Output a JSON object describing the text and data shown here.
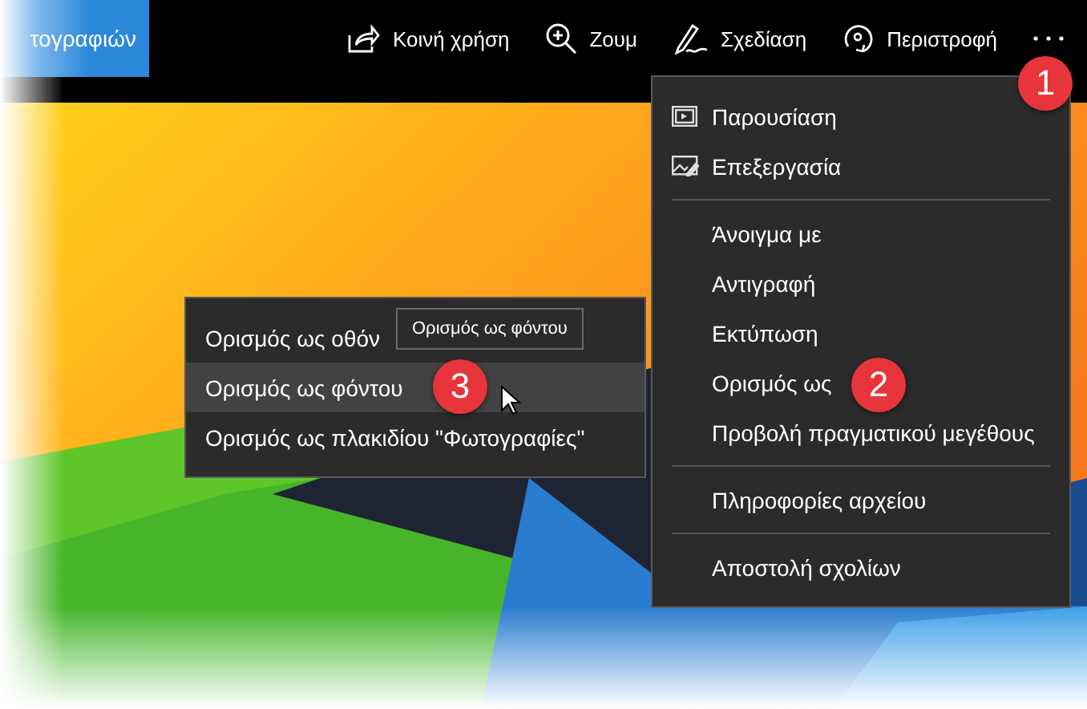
{
  "app_tab": {
    "title": "τογραφιών"
  },
  "toolbar": [
    {
      "kind": "share",
      "label": "Κοινή χρήση"
    },
    {
      "kind": "zoom",
      "label": "Ζουμ"
    },
    {
      "kind": "draw",
      "label": "Σχεδίαση"
    },
    {
      "kind": "rotate",
      "label": "Περιστροφή"
    },
    {
      "kind": "more"
    }
  ],
  "menu": {
    "groups": [
      [
        {
          "kind": "slideshow",
          "label": "Παρουσίαση"
        },
        {
          "kind": "edit",
          "label": "Επεξεργασία"
        }
      ],
      [
        {
          "kind": "plain",
          "label": "Άνοιγμα με"
        },
        {
          "kind": "plain",
          "label": "Αντιγραφή"
        },
        {
          "kind": "plain",
          "label": "Εκτύπωση"
        },
        {
          "kind": "plain",
          "label": "Ορισμός ως"
        },
        {
          "kind": "plain",
          "label": "Προβολή πραγματικού μεγέθους"
        }
      ],
      [
        {
          "kind": "plain",
          "label": "Πληροφορίες αρχείου"
        }
      ],
      [
        {
          "kind": "plain",
          "label": "Αποστολή σχολίων"
        }
      ]
    ]
  },
  "submenu": {
    "items": [
      {
        "label": "Ορισμός ως οθόν",
        "selected": false
      },
      {
        "label": "Ορισμός ως φόντου",
        "selected": true
      },
      {
        "label": "Ορισμός ως πλακιδίου \"Φωτογραφίες\"",
        "selected": false
      }
    ]
  },
  "tooltip": {
    "text": "Ορισμός ως φόντου"
  },
  "badges": [
    {
      "text": "1"
    },
    {
      "text": "2"
    },
    {
      "text": "3"
    }
  ]
}
